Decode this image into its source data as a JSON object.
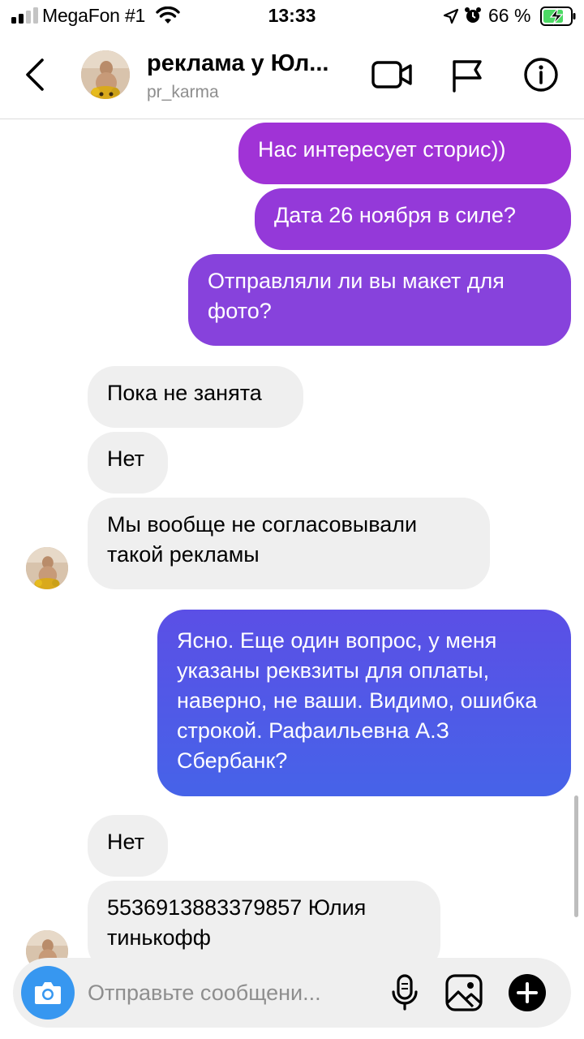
{
  "status_bar": {
    "carrier": "MegaFon #1",
    "time": "13:33",
    "battery": "66 %"
  },
  "header": {
    "title": "реклама у Юл...",
    "username": "pr_karma",
    "icons": [
      "back-icon",
      "video-call-icon",
      "flag-icon",
      "info-icon"
    ]
  },
  "messages": [
    {
      "side": "out",
      "text": "Нас интересует сторис))"
    },
    {
      "side": "out",
      "text": "Дата 26 ноября в силе?"
    },
    {
      "side": "out",
      "text": "Отправляли ли вы макет для фото?"
    },
    {
      "side": "in",
      "text": "Пока не занята"
    },
    {
      "side": "in",
      "text": "Нет"
    },
    {
      "side": "in",
      "text": "Мы вообще не согласовывали такой рекламы"
    },
    {
      "side": "out",
      "text": "Ясно. Еще один вопрос, у меня указаны реквзиты для оплаты, наверно, не ваши. Видимо, ошибка строкой. Рафаильевна А.З Сбербанк?"
    },
    {
      "side": "in",
      "text": "Нет"
    },
    {
      "side": "in",
      "text": "5536913883379857 Юлия тинькофф"
    }
  ],
  "composer": {
    "placeholder": "Отправьте сообщени..."
  },
  "colors": {
    "purple": "#a033d6",
    "violet": "#7d4fe0",
    "blue": "#4d5fe6",
    "incoming": "#efefef",
    "camera": "#3797f0"
  }
}
